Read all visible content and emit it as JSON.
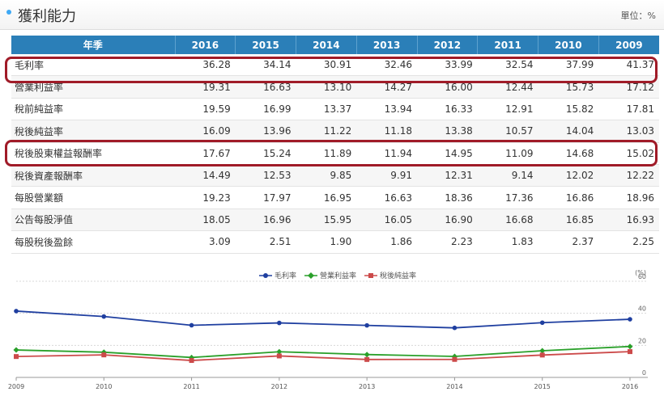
{
  "header": {
    "title": "獲利能力",
    "unit": "單位：%"
  },
  "table": {
    "corner": "年季",
    "years": [
      "2016",
      "2015",
      "2014",
      "2013",
      "2012",
      "2011",
      "2010",
      "2009"
    ],
    "rows": [
      {
        "label": "毛利率",
        "values": [
          "36.28",
          "34.14",
          "30.91",
          "32.46",
          "33.99",
          "32.54",
          "37.99",
          "41.37"
        ]
      },
      {
        "label": "營業利益率",
        "values": [
          "19.31",
          "16.63",
          "13.10",
          "14.27",
          "16.00",
          "12.44",
          "15.73",
          "17.12"
        ]
      },
      {
        "label": "稅前純益率",
        "values": [
          "19.59",
          "16.99",
          "13.37",
          "13.94",
          "16.33",
          "12.91",
          "15.82",
          "17.81"
        ]
      },
      {
        "label": "稅後純益率",
        "values": [
          "16.09",
          "13.96",
          "11.22",
          "11.18",
          "13.38",
          "10.57",
          "14.04",
          "13.03"
        ]
      },
      {
        "label": "稅後股東權益報酬率",
        "values": [
          "17.67",
          "15.24",
          "11.89",
          "11.94",
          "14.95",
          "11.09",
          "14.68",
          "15.02"
        ]
      },
      {
        "label": "稅後資產報酬率",
        "values": [
          "14.49",
          "12.53",
          "9.85",
          "9.91",
          "12.31",
          "9.14",
          "12.02",
          "12.22"
        ]
      },
      {
        "label": "每股營業額",
        "values": [
          "19.23",
          "17.97",
          "16.95",
          "16.63",
          "18.36",
          "17.36",
          "16.86",
          "18.96"
        ]
      },
      {
        "label": "公告每股淨值",
        "values": [
          "18.05",
          "16.96",
          "15.95",
          "16.05",
          "16.90",
          "16.68",
          "16.85",
          "16.93"
        ]
      },
      {
        "label": "每股稅後盈餘",
        "values": [
          "3.09",
          "2.51",
          "1.90",
          "1.86",
          "2.23",
          "1.83",
          "2.37",
          "2.25"
        ]
      }
    ]
  },
  "chart_data": {
    "type": "line",
    "x": [
      "2009",
      "2010",
      "2011",
      "2012",
      "2013",
      "2014",
      "2015",
      "2016"
    ],
    "series": [
      {
        "name": "毛利率",
        "color": "#1f3fa0",
        "values": [
          41.37,
          37.99,
          32.54,
          33.99,
          32.46,
          30.91,
          34.14,
          36.28
        ]
      },
      {
        "name": "營業利益率",
        "color": "#2aa02a",
        "values": [
          17.12,
          15.73,
          12.44,
          16.0,
          14.27,
          13.1,
          16.63,
          19.31
        ]
      },
      {
        "name": "稅後純益率",
        "color": "#cc4a4a",
        "values": [
          13.03,
          14.04,
          10.57,
          13.38,
          11.18,
          11.22,
          13.96,
          16.09
        ]
      }
    ],
    "yunit": "(%)",
    "yticks": [
      "0",
      "20",
      "40",
      "60"
    ],
    "ylim": [
      0,
      60
    ],
    "grid": true,
    "legend": "top-center"
  }
}
